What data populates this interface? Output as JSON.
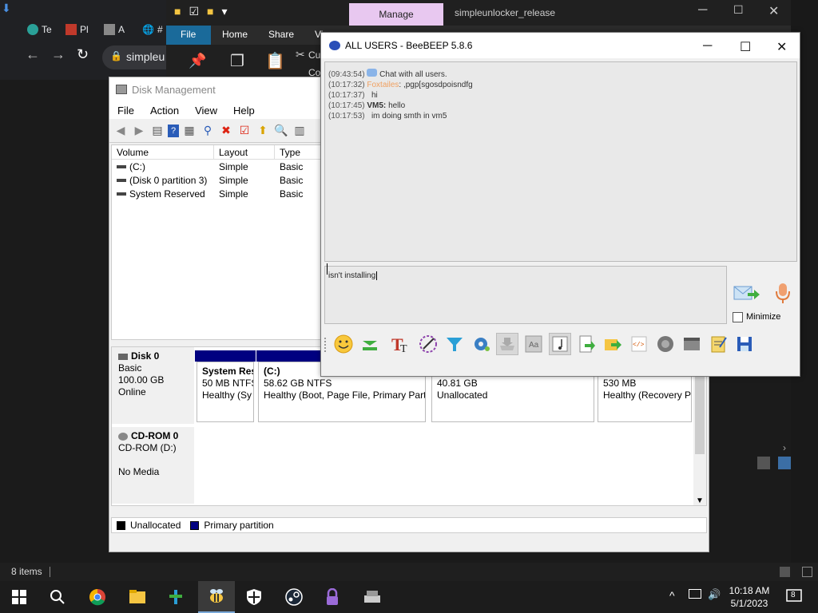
{
  "chrome": {
    "tabs": [
      {
        "label": "Te"
      },
      {
        "label": "Pl"
      },
      {
        "label": "A"
      },
      {
        "label": "#"
      }
    ],
    "omnibox": "simpleu"
  },
  "explorer": {
    "manage_tab": "Manage",
    "title": "simpleunlocker_release",
    "ribbon_tabs": [
      "File",
      "Home",
      "Share",
      "Vi"
    ],
    "ribbon_frag": [
      "Cu",
      "Co"
    ]
  },
  "disk_management": {
    "title": "Disk Management",
    "menu": [
      "File",
      "Action",
      "View",
      "Help"
    ],
    "columns": [
      "Volume",
      "Layout",
      "Type"
    ],
    "volumes": [
      {
        "volume": "(C:)",
        "layout": "Simple",
        "type": "Basic"
      },
      {
        "volume": "(Disk 0 partition 3)",
        "layout": "Simple",
        "type": "Basic"
      },
      {
        "volume": "System Reserved",
        "layout": "Simple",
        "type": "Basic"
      }
    ],
    "disk0": {
      "name": "Disk 0",
      "kind": "Basic",
      "size": "100.00 GB",
      "status": "Online"
    },
    "partitions": [
      {
        "name": "System Res",
        "size": "50 MB NTFS",
        "status": "Healthy (Sy"
      },
      {
        "name": "(C:)",
        "size": "58.62 GB NTFS",
        "status": "Healthy (Boot, Page File, Primary Parti"
      },
      {
        "name": "",
        "size": "40.81 GB",
        "status": "Unallocated"
      },
      {
        "name": "",
        "size": "530 MB",
        "status": "Healthy (Recovery Pa"
      }
    ],
    "cdrom": {
      "name": "CD-ROM 0",
      "kind": "CD-ROM (D:)",
      "media": "No Media"
    },
    "legend": [
      {
        "label": "Unallocated",
        "color": "#000000"
      },
      {
        "label": "Primary partition",
        "color": "#000080"
      }
    ]
  },
  "beebeep": {
    "title": "ALL USERS - BeeBEEP 5.8.6",
    "messages": [
      {
        "time": "(09:43:54)",
        "who": "",
        "text": "Chat with all users."
      },
      {
        "time": "(10:17:32)",
        "who": "Foxtailes",
        "text": ": ,pgp[sgosdpoisndfg"
      },
      {
        "time": "(10:17:37)",
        "who": "",
        "text": "hi"
      },
      {
        "time": "(10:17:45)",
        "who": "VM5:",
        "text": "hello"
      },
      {
        "time": "(10:17:53)",
        "who": "",
        "text": "im doing smth in vm5"
      }
    ],
    "input_value": "isn't installing",
    "minimize_label": "Minimize"
  },
  "status_bar": {
    "items": "8 items"
  },
  "taskbar": {
    "time": "10:18 AM",
    "date": "5/1/2023",
    "notifications": "8"
  }
}
